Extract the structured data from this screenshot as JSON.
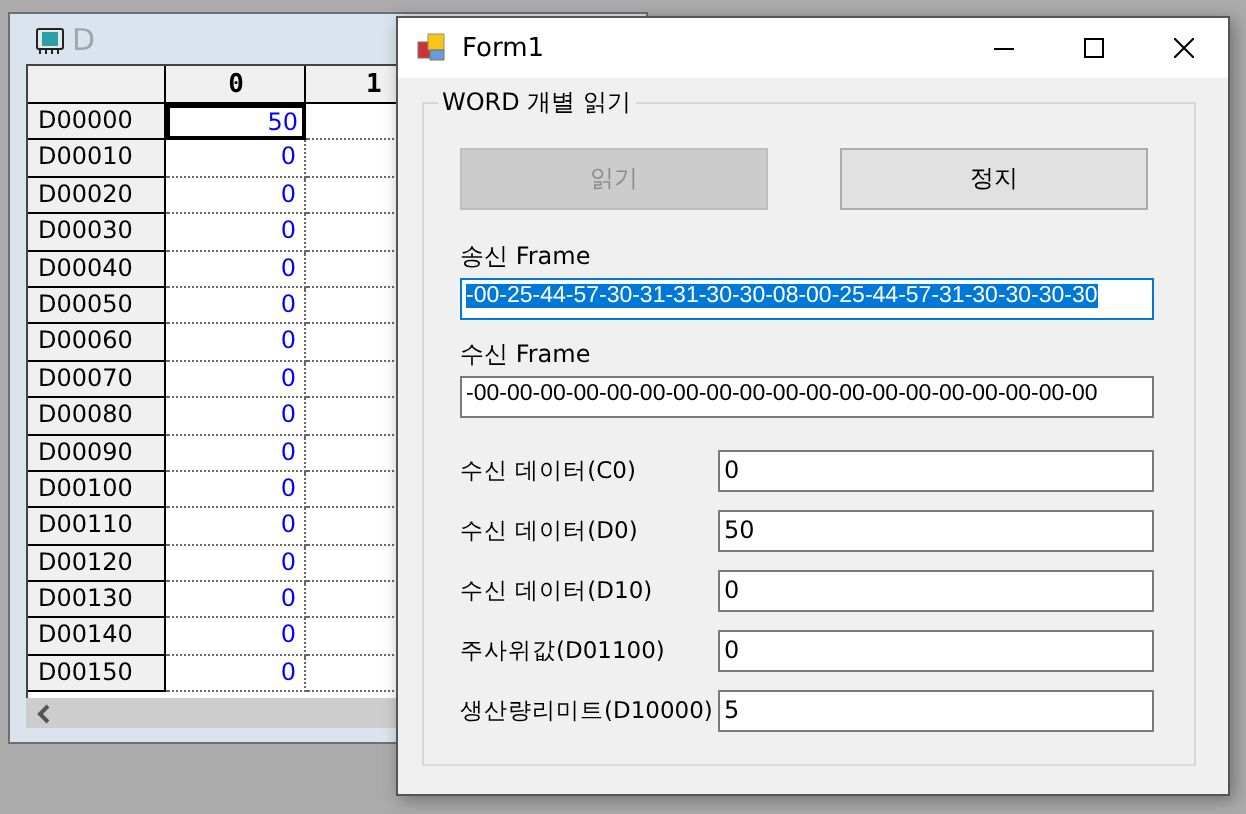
{
  "background_window": {
    "title": "D",
    "grid": {
      "columns": [
        "0",
        "1"
      ],
      "rows": [
        {
          "label": "D00000",
          "value": "50",
          "selected": true
        },
        {
          "label": "D00010",
          "value": "0",
          "selected": false
        },
        {
          "label": "D00020",
          "value": "0",
          "selected": false
        },
        {
          "label": "D00030",
          "value": "0",
          "selected": false
        },
        {
          "label": "D00040",
          "value": "0",
          "selected": false
        },
        {
          "label": "D00050",
          "value": "0",
          "selected": false
        },
        {
          "label": "D00060",
          "value": "0",
          "selected": false
        },
        {
          "label": "D00070",
          "value": "0",
          "selected": false
        },
        {
          "label": "D00080",
          "value": "0",
          "selected": false
        },
        {
          "label": "D00090",
          "value": "0",
          "selected": false
        },
        {
          "label": "D00100",
          "value": "0",
          "selected": false
        },
        {
          "label": "D00110",
          "value": "0",
          "selected": false
        },
        {
          "label": "D00120",
          "value": "0",
          "selected": false
        },
        {
          "label": "D00130",
          "value": "0",
          "selected": false
        },
        {
          "label": "D00140",
          "value": "0",
          "selected": false
        },
        {
          "label": "D00150",
          "value": "0",
          "selected": false
        }
      ]
    }
  },
  "form": {
    "title": "Form1",
    "group": {
      "title": "WORD 개별 읽기",
      "buttons": [
        {
          "label": "읽기",
          "disabled": true
        },
        {
          "label": "정지",
          "disabled": false
        }
      ],
      "send_frame": {
        "label": "송신 Frame",
        "value": "-00-25-44-57-30-31-31-30-30-08-00-25-44-57-31-30-30-30-30",
        "text_selected": true
      },
      "receive_frame": {
        "label": "수신 Frame",
        "value": "-00-00-00-00-00-00-00-00-00-00-00-00-00-00-00-00-00-00-00",
        "text_selected": false
      },
      "fields": [
        {
          "label": "수신 데이터(C0)",
          "value": "0"
        },
        {
          "label": "수신 데이터(D0)",
          "value": "50"
        },
        {
          "label": "수신 데이터(D10)",
          "value": "0"
        },
        {
          "label": "주사위값(D01100)",
          "value": "0"
        },
        {
          "label": "생산량리미트(D10000)",
          "value": "5"
        }
      ]
    }
  }
}
